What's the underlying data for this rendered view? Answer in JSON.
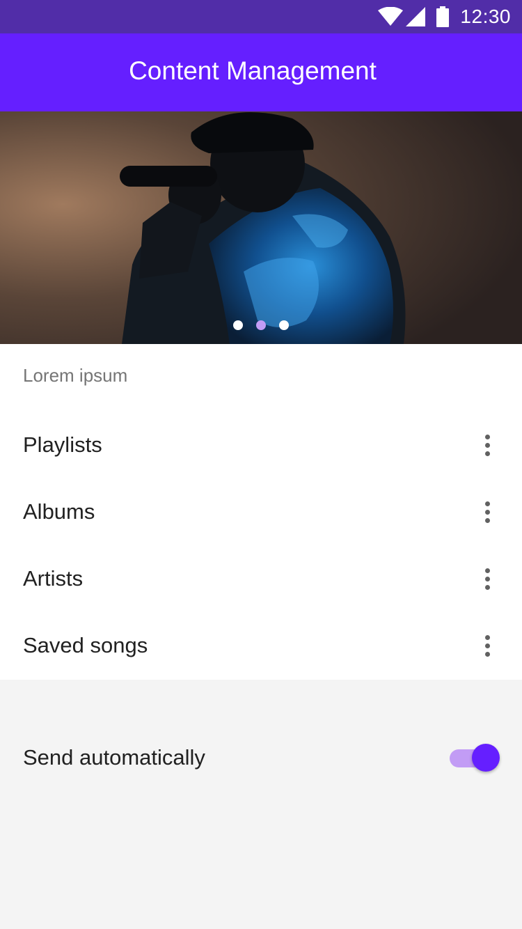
{
  "status_bar": {
    "time": "12:30",
    "icons": [
      "wifi-icon",
      "cellular-signal-icon",
      "battery-icon"
    ],
    "background": "#512da8"
  },
  "app_bar": {
    "title": "Content Management",
    "background": "#651fff"
  },
  "carousel": {
    "image": "concert-singer-photo",
    "page_count": 3,
    "active_index": 1,
    "dot_color": "#ffffff",
    "active_dot_color": "#c29cf5"
  },
  "list": {
    "subheader": "Lorem ipsum",
    "items": [
      {
        "label": "Playlists",
        "action_icon": "more-vert-icon"
      },
      {
        "label": "Albums",
        "action_icon": "more-vert-icon"
      },
      {
        "label": "Artists",
        "action_icon": "more-vert-icon"
      },
      {
        "label": "Saved songs",
        "action_icon": "more-vert-icon"
      }
    ]
  },
  "settings": {
    "send_automatically": {
      "label": "Send automatically",
      "enabled": true,
      "accent": "#651fff"
    }
  }
}
